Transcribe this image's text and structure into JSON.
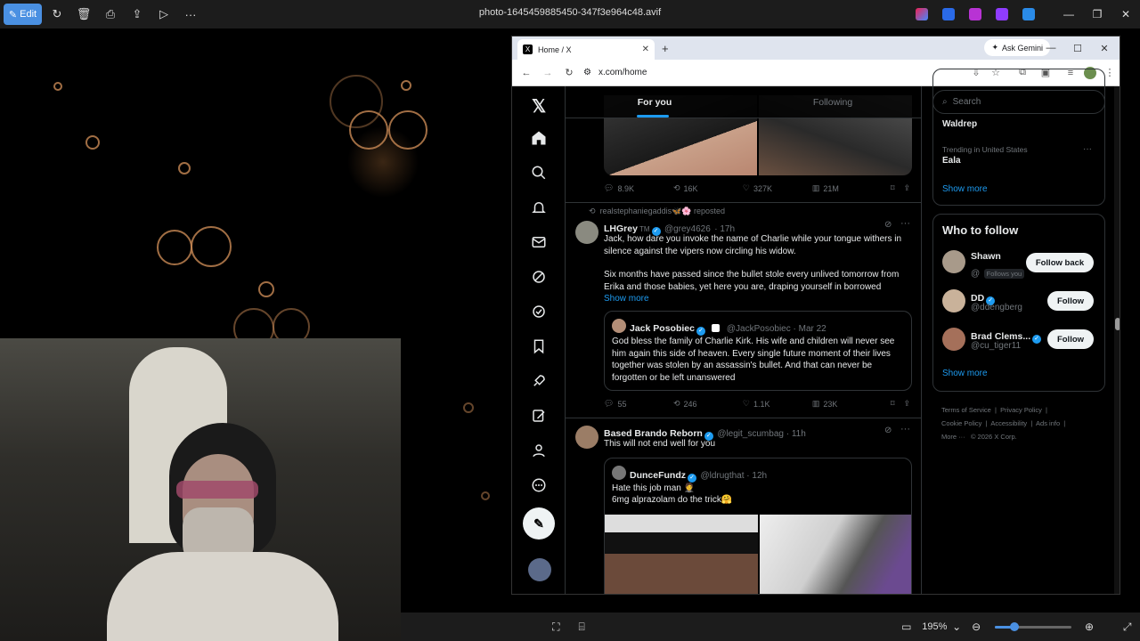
{
  "viewer": {
    "edit_label": "Edit",
    "file_name": "photo-1645459885450-347f3e964c48.avif",
    "zoom": "195%",
    "zoom_fraction": 0.25
  },
  "browser": {
    "tab_title": "Home / X",
    "tab_icon": "X",
    "ask_gemini": "Ask Gemini",
    "url": "x.com/home"
  },
  "x": {
    "tabs": {
      "for_you": "For you",
      "following": "Following"
    },
    "post1_stats": {
      "replies": "8.9K",
      "reposts": "16K",
      "likes": "327K",
      "views": "21M"
    },
    "post2": {
      "repost_note": "realstephaniegaddis🦋🌸 reposted",
      "name": "LHGrey",
      "tag": "TM",
      "handle": "@grey4626",
      "time": "· 17h",
      "text1": "Jack, how dare you invoke the name of Charlie while your tongue withers in silence against the vipers now circling his widow.",
      "text2": "Six months have passed since the bullet stole every unlived tomorrow from Erika and those babies, yet here you are, draping yourself in borrowed",
      "show_more": "Show more",
      "quote_name": "Jack Posobiec",
      "quote_handle": "@JackPosobiec · Mar 22",
      "quote_text": "God bless the family of Charlie Kirk. His wife and children will never see him again this side of heaven. Every single future moment of their lives together was stolen by an assassin's bullet. And that can never be forgotten or be left unanswered",
      "stats": {
        "replies": "55",
        "reposts": "246",
        "likes": "1.1K",
        "views": "23K"
      }
    },
    "post3": {
      "name": "Based Brando Reborn",
      "handle": "@legit_scumbag · 11h",
      "text": "This will not end well for you",
      "quote_name": "DunceFundz",
      "quote_handle": "@ldrugthat · 12h",
      "quote_line1": "Hate this job man 🤵",
      "quote_line2": "6mg alprazolam do the trick🤗"
    },
    "right": {
      "search_placeholder": "Search",
      "trend1": "Waldrep",
      "trend2_meta": "Trending in United States",
      "trend2": "Eala",
      "show_more": "Show more",
      "wtf_title": "Who to follow",
      "follows": [
        {
          "name": "Shawn",
          "handle": "@",
          "badge": "Follows you",
          "button": "Follow back"
        },
        {
          "name": "DD",
          "handle": "@ddengberg",
          "button": "Follow"
        },
        {
          "name": "Brad Clems...",
          "handle": "@cu_tiger11",
          "button": "Follow"
        }
      ],
      "wtf_show_more": "Show more",
      "footer": {
        "terms": "Terms of Service",
        "privacy": "Privacy Policy",
        "cookie": "Cookie Policy",
        "accessibility": "Accessibility",
        "ads": "Ads info",
        "more": "More ···",
        "copyright": "© 2026 X Corp."
      }
    }
  },
  "colors": {
    "accent": "#1d9bf0",
    "border": "#2f3336",
    "muted": "#71767b"
  }
}
